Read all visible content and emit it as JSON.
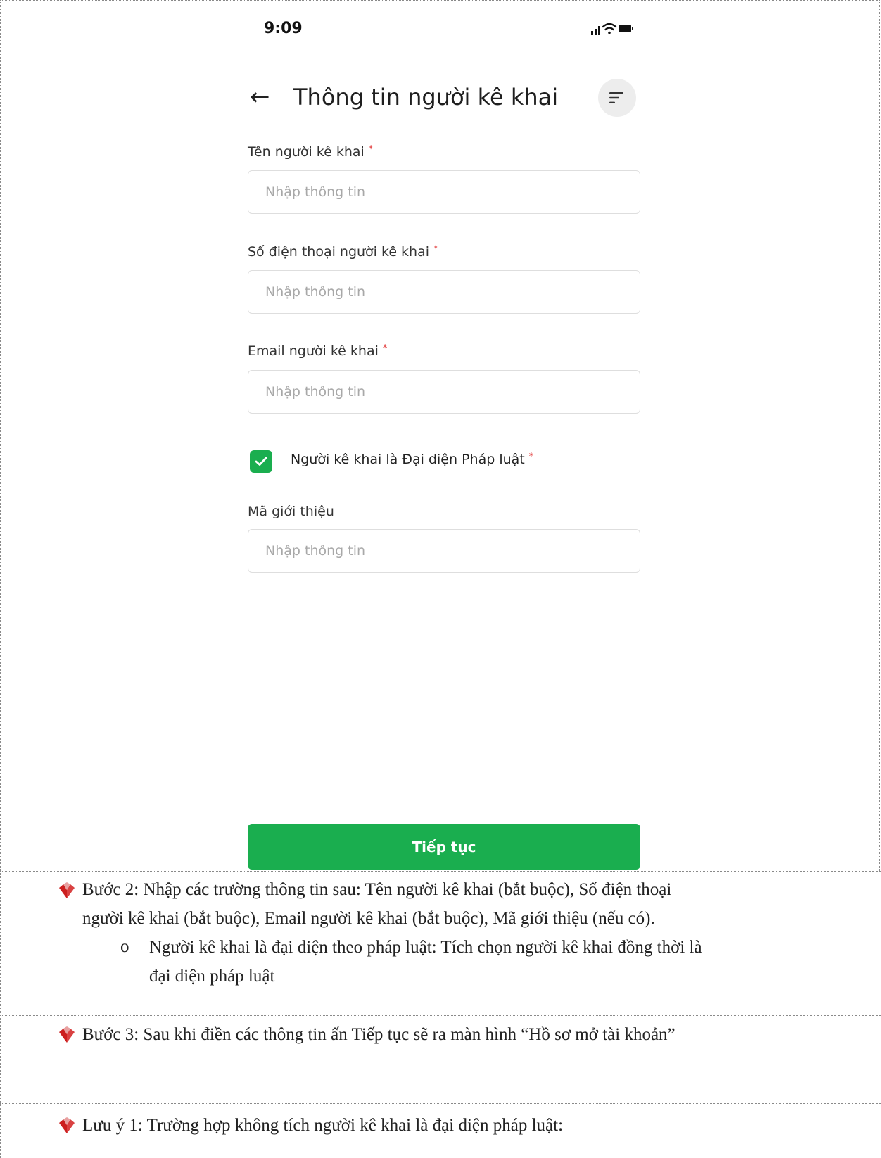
{
  "status_bar": {
    "time": "9:09"
  },
  "header": {
    "title": "Thông tin người kê khai"
  },
  "fields": [
    {
      "label": "Tên người kê khai",
      "required_mark": "*",
      "placeholder": "Nhập thông tin"
    },
    {
      "label": "Số điện thoại người kê khai",
      "required_mark": "*",
      "placeholder": "Nhập thông tin"
    },
    {
      "label": "Email người kê khai",
      "required_mark": "*",
      "placeholder": "Nhập thông tin"
    }
  ],
  "checkbox": {
    "label": "Người kê khai là Đại diện Pháp luật",
    "required_mark": "*",
    "checked": true
  },
  "referral": {
    "label": "Mã giới thiệu",
    "placeholder": "Nhập thông tin"
  },
  "continue_button": {
    "label": "Tiếp tục"
  },
  "accent_color": "#1aae4f",
  "bullet_color": "#cc1f1f",
  "doc": {
    "step2_line1": "Bước 2: Nhập các trường thông tin sau: Tên người kê khai (bắt buộc), Số điện thoại",
    "step2_line2": "người kê khai (bắt buộc), Email người kê khai (bắt buộc), Mã giới thiệu (nếu có).",
    "sub_bullet_marker": "o",
    "sub_line1": "Người kê khai là đại diện theo pháp luật: Tích  chọn người kê khai đồng thời là",
    "sub_line2": "đại diện pháp luật",
    "step3": "Bước 3: Sau khi điền các thông tin ấn Tiếp tục sẽ ra màn hình “Hồ sơ mở tài khoản”",
    "note1": "Lưu ý 1: Trường hợp không tích người kê khai là đại diện pháp luật:"
  }
}
